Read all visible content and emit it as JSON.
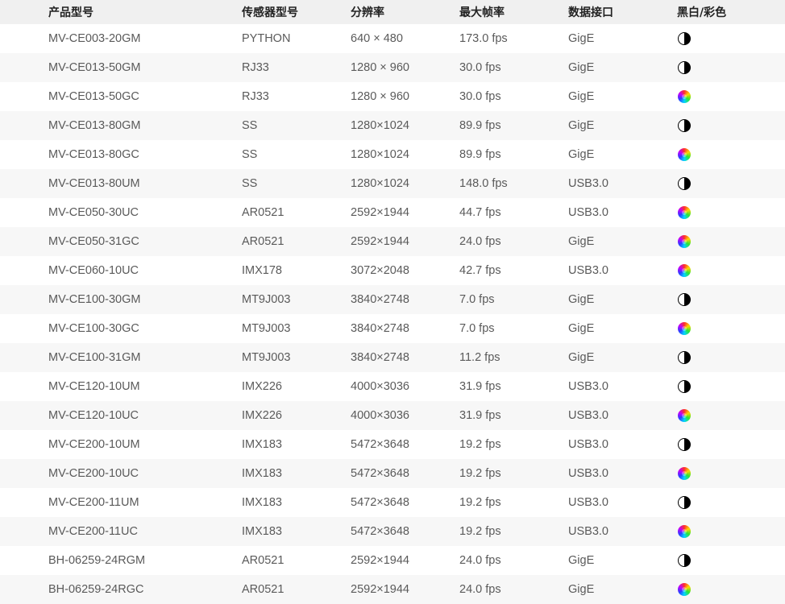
{
  "table": {
    "headers": [
      "产品型号",
      "传感器型号",
      "分辨率",
      "最大帧率",
      "数据接口",
      "黑白/彩色"
    ],
    "rows": [
      {
        "model": "MV-CE003-20GM",
        "sensor": "PYTHON",
        "resolution": "640 × 480",
        "framerate": "173.0 fps",
        "interface": "GigE",
        "type_icon": "monochrome-icon"
      },
      {
        "model": "MV-CE013-50GM",
        "sensor": "RJ33",
        "resolution": "1280 × 960",
        "framerate": "30.0 fps",
        "interface": "GigE",
        "type_icon": "monochrome-icon"
      },
      {
        "model": "MV-CE013-50GC",
        "sensor": "RJ33",
        "resolution": "1280 × 960",
        "framerate": "30.0 fps",
        "interface": "GigE",
        "type_icon": "color-wheel-icon"
      },
      {
        "model": "MV-CE013-80GM",
        "sensor": "SS",
        "resolution": "1280×1024",
        "framerate": "89.9 fps",
        "interface": "GigE",
        "type_icon": "monochrome-icon"
      },
      {
        "model": "MV-CE013-80GC",
        "sensor": "SS",
        "resolution": "1280×1024",
        "framerate": "89.9 fps",
        "interface": "GigE",
        "type_icon": "color-wheel-icon"
      },
      {
        "model": "MV-CE013-80UM",
        "sensor": "SS",
        "resolution": "1280×1024",
        "framerate": "148.0 fps",
        "interface": "USB3.0",
        "type_icon": "monochrome-icon"
      },
      {
        "model": "MV-CE050-30UC",
        "sensor": "AR0521",
        "resolution": "2592×1944",
        "framerate": "44.7 fps",
        "interface": "USB3.0",
        "type_icon": "color-wheel-icon"
      },
      {
        "model": "MV-CE050-31GC",
        "sensor": "AR0521",
        "resolution": "2592×1944",
        "framerate": "24.0 fps",
        "interface": "GigE",
        "type_icon": "color-wheel-icon"
      },
      {
        "model": "MV-CE060-10UC",
        "sensor": "IMX178",
        "resolution": "3072×2048",
        "framerate": "42.7 fps",
        "interface": "USB3.0",
        "type_icon": "color-wheel-icon"
      },
      {
        "model": "MV-CE100-30GM",
        "sensor": "MT9J003",
        "resolution": "3840×2748",
        "framerate": "7.0 fps",
        "interface": "GigE",
        "type_icon": "monochrome-icon"
      },
      {
        "model": "MV-CE100-30GC",
        "sensor": "MT9J003",
        "resolution": "3840×2748",
        "framerate": "7.0 fps",
        "interface": "GigE",
        "type_icon": "color-wheel-icon"
      },
      {
        "model": "MV-CE100-31GM",
        "sensor": "MT9J003",
        "resolution": "3840×2748",
        "framerate": "11.2 fps",
        "interface": "GigE",
        "type_icon": "monochrome-icon"
      },
      {
        "model": "MV-CE120-10UM",
        "sensor": "IMX226",
        "resolution": "4000×3036",
        "framerate": "31.9 fps",
        "interface": "USB3.0",
        "type_icon": "monochrome-icon"
      },
      {
        "model": "MV-CE120-10UC",
        "sensor": "IMX226",
        "resolution": "4000×3036",
        "framerate": "31.9 fps",
        "interface": "USB3.0",
        "type_icon": "color-wheel-icon"
      },
      {
        "model": "MV-CE200-10UM",
        "sensor": "IMX183",
        "resolution": "5472×3648",
        "framerate": "19.2 fps",
        "interface": "USB3.0",
        "type_icon": "monochrome-icon"
      },
      {
        "model": "MV-CE200-10UC",
        "sensor": "IMX183",
        "resolution": "5472×3648",
        "framerate": "19.2 fps",
        "interface": "USB3.0",
        "type_icon": "color-wheel-icon"
      },
      {
        "model": "MV-CE200-11UM",
        "sensor": "IMX183",
        "resolution": "5472×3648",
        "framerate": "19.2 fps",
        "interface": "USB3.0",
        "type_icon": "monochrome-icon"
      },
      {
        "model": "MV-CE200-11UC",
        "sensor": "IMX183",
        "resolution": "5472×3648",
        "framerate": "19.2 fps",
        "interface": "USB3.0",
        "type_icon": "color-wheel-icon"
      },
      {
        "model": "BH-06259-24RGM",
        "sensor": "AR0521",
        "resolution": "2592×1944",
        "framerate": "24.0 fps",
        "interface": "GigE",
        "type_icon": "monochrome-icon"
      },
      {
        "model": "BH-06259-24RGC",
        "sensor": "AR0521",
        "resolution": "2592×1944",
        "framerate": "24.0 fps",
        "interface": "GigE",
        "type_icon": "color-wheel-icon"
      }
    ]
  },
  "colors": {
    "header_background": "#f0f0f0",
    "stripe_background": "#f7f7f7",
    "text": "#5a5a5a",
    "header_text": "#222222"
  }
}
